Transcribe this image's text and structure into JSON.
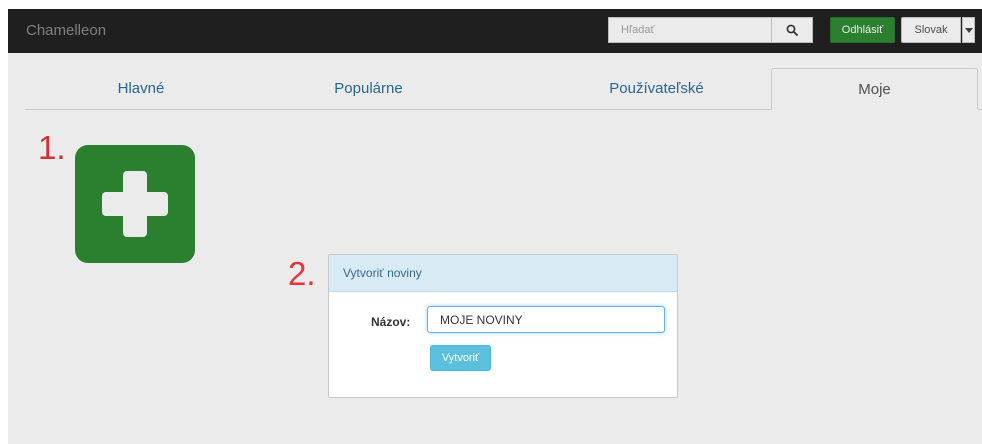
{
  "navbar": {
    "brand": "Chamelleon",
    "search_placeholder": "Hľadať",
    "search_icon": "search-icon",
    "logout_label": "Odhlásiť",
    "language": "Slovak",
    "colors": {
      "background": "#222222",
      "logout": "#2e8b34"
    }
  },
  "tabs": [
    {
      "label": "Hlavné",
      "active": false
    },
    {
      "label": "Populárne",
      "active": false
    },
    {
      "label": "Používateľské",
      "active": false
    },
    {
      "label": "Moje",
      "active": true
    }
  ],
  "annotations": {
    "step1": "1.",
    "step2": "2.",
    "color": "#e8333a"
  },
  "add_tile": {
    "icon": "plus-icon",
    "color": "#2e8b34"
  },
  "modal": {
    "title": "Vytvoriť noviny",
    "field_label": "Názov:",
    "field_value": "MOJE NOVINY",
    "submit_label": "Vytvoriť",
    "colors": {
      "header": "#d8eaf4",
      "submit": "#5bc0de"
    }
  }
}
